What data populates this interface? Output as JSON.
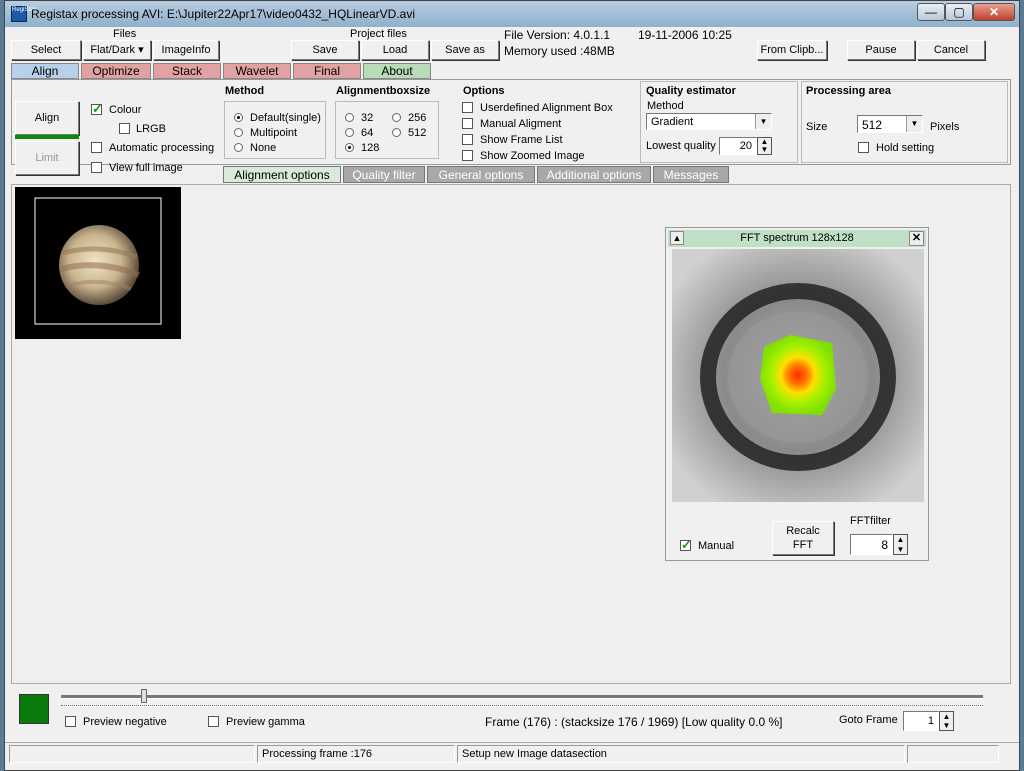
{
  "window": {
    "title": "Registax processing AVI: E:\\Jupiter22Apr17\\video0432_HQLinearVD.avi",
    "icon_text": "RegiStax",
    "controls": {
      "minimize": "—",
      "maximize": "▢",
      "close": "✕"
    }
  },
  "toolbar": {
    "files_group": "Files",
    "select": "Select",
    "flatdark": "Flat/Dark ▾",
    "imageinfo": "ImageInfo",
    "project_group": "Project files",
    "save": "Save",
    "load": "Load",
    "saveas": "Save as",
    "file_version": "File Version: 4.0.1.1",
    "date": "19-11-2006 10:25",
    "memory": "Memory used :48MB",
    "from_clip": "From Clipb...",
    "pause": "Pause",
    "cancel": "Cancel"
  },
  "tabs": [
    {
      "label": "Align",
      "color": "#b8d0ec"
    },
    {
      "label": "Optimize",
      "color": "#e2a2a2"
    },
    {
      "label": "Stack",
      "color": "#e2a2a2"
    },
    {
      "label": "Wavelet",
      "color": "#e2a2a2"
    },
    {
      "label": "Final",
      "color": "#e2a2a2"
    },
    {
      "label": "About",
      "color": "#b8dcb8"
    }
  ],
  "left_controls": {
    "align_button": "Align",
    "limit_button": "Limit",
    "colour": "Colour",
    "lrgb": "LRGB",
    "auto_processing": "Automatic processing",
    "view_full": "View full image"
  },
  "method": {
    "title": "Method",
    "options": [
      "Default(single)",
      "Multipoint",
      "None"
    ],
    "selected": "Default(single)"
  },
  "alignbox": {
    "title": "Alignmentboxsize",
    "options": [
      "32",
      "256",
      "64",
      "512",
      "128"
    ],
    "selected": "128"
  },
  "options": {
    "title": "Options",
    "items": [
      "Userdefined Alignment Box",
      "Manual Aligment",
      "Show Frame List",
      "Show Zoomed Image"
    ]
  },
  "quality": {
    "title": "Quality estimator",
    "method_label": "Method",
    "method_value": "Gradient",
    "lowest_label": "Lowest quality",
    "lowest_value": "20"
  },
  "processing_area": {
    "title": "Processing area",
    "size_label": "Size",
    "size_value": "512",
    "pixels_label": "Pixels",
    "hold": "Hold setting"
  },
  "subtabs": [
    "Alignment  options",
    "Quality  filter",
    "General options",
    "Additional options",
    "Messages"
  ],
  "fft": {
    "title": "FFT spectrum 128x128",
    "manual": "Manual",
    "recalc_line1": "Recalc",
    "recalc_line2": "FFT",
    "filter_label": "FFTfilter",
    "filter_value": "8"
  },
  "bottom": {
    "preview_negative": "Preview negative",
    "preview_gamma": "Preview gamma",
    "frame_info": "Frame (176) :  (stacksize 176 / 1969) [Low quality 0.0 %]",
    "goto_label": "Goto Frame",
    "goto_value": "1",
    "slider_fraction": 0.09,
    "swatch_color": "#0a7a0a"
  },
  "status": {
    "processing": "Processing frame :176",
    "message": "Setup new Image datasection"
  }
}
